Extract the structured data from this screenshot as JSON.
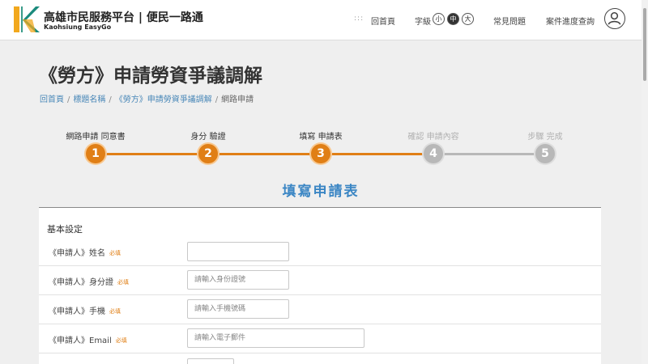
{
  "header": {
    "brand_title": "高雄市民服務平台 | 便民一路通",
    "brand_subtitle": "Kaohsiung EasyGo",
    "logo_icon": "kaohsiung-k-logo",
    "nav_dots": ":::",
    "home_label": "回首頁",
    "font_size_label": "字級",
    "font_sizes": [
      "小",
      "中",
      "大"
    ],
    "font_size_selected": "中",
    "faq_label": "常見問題",
    "case_query_label": "案件進度查詢",
    "user_icon": "user-icon"
  },
  "page": {
    "title": "《勞方》申請勞資爭議調解",
    "breadcrumb": [
      "回首頁",
      "標題名稱",
      "《勞方》申請勞資爭議調解",
      "網路申請"
    ]
  },
  "stepper": {
    "steps": [
      {
        "number": "1",
        "label": "網路申請 同意書",
        "status": "done"
      },
      {
        "number": "2",
        "label": "身分 驗證",
        "status": "done"
      },
      {
        "number": "3",
        "label": "填寫 申請表",
        "status": "done"
      },
      {
        "number": "4",
        "label": "確認 申請內容",
        "status": "todo"
      },
      {
        "number": "5",
        "label": "步驟 完成",
        "status": "todo"
      }
    ],
    "done_color": "#e07f16",
    "todo_color": "#b8b8b8"
  },
  "form": {
    "title": "填寫申請表",
    "section_title": "基本設定",
    "required_label": "必填",
    "fields": [
      {
        "label": "《申請人》姓名",
        "placeholder": "",
        "value": ""
      },
      {
        "label": "《申請人》身分證",
        "placeholder": "請輸入身份證號",
        "value": ""
      },
      {
        "label": "《申請人》手機",
        "placeholder": "請輸入手機號碼",
        "value": ""
      },
      {
        "label": "《申請人》Email",
        "placeholder": "請輸入電子郵件",
        "value": ""
      }
    ]
  }
}
